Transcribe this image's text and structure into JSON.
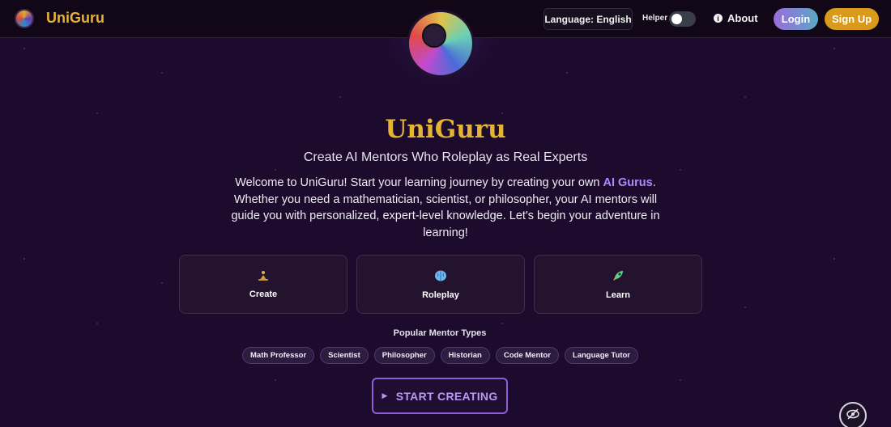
{
  "navbar": {
    "brand_name": "UniGuru",
    "language_label": "Language: English",
    "helper_label": "Helper",
    "about_label": "About",
    "login_label": "Login",
    "signup_label": "Sign Up"
  },
  "hero": {
    "title": "UniGuru",
    "subtitle": "Create AI Mentors Who Roleplay as Real Experts",
    "desc_before": "Welcome to UniGuru! Start your learning journey by creating your own ",
    "desc_highlight": "AI Gurus",
    "desc_after": ". Whether you need a mathematician, scientist, or philosopher, your AI mentors will guide you with personalized, expert-level knowledge. Let's begin your adventure in learning!"
  },
  "features": [
    {
      "label": "Create",
      "icon": "person-meditating-icon"
    },
    {
      "label": "Roleplay",
      "icon": "brain-icon"
    },
    {
      "label": "Learn",
      "icon": "rocket-icon"
    }
  ],
  "mentor_types": {
    "heading": "Popular Mentor Types",
    "chips": [
      "Math Professor",
      "Scientist",
      "Philosopher",
      "Historian",
      "Code Mentor",
      "Language Tutor"
    ]
  },
  "cta": {
    "label": "START CREATING"
  },
  "colors": {
    "brand_gold": "#e4b434",
    "accent_purple": "#a98bff",
    "signup_orange": "#d99a1c",
    "background": "#1c0b2c"
  },
  "helper_toggle_on": false
}
